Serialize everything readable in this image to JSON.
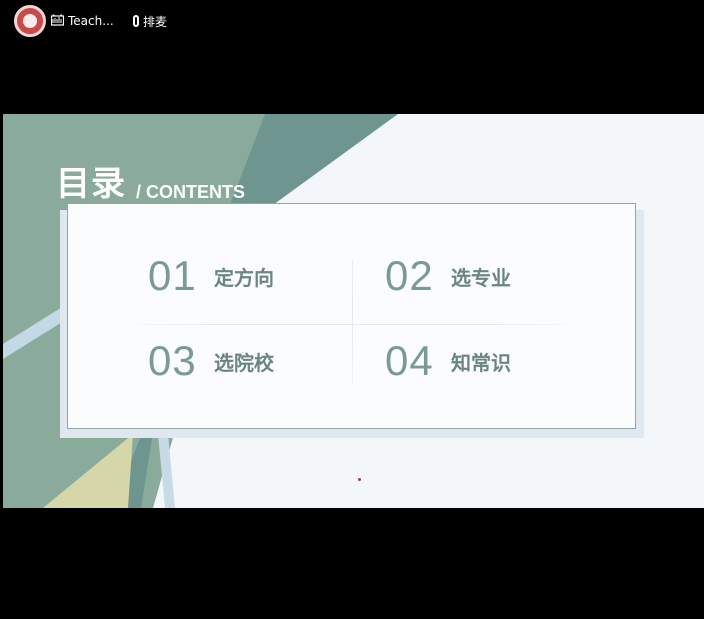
{
  "topbar": {
    "app_label": "Teach...",
    "mic_label": "排麦"
  },
  "slide": {
    "title": "目录",
    "subtitle": "/ CONTENTS",
    "items": [
      {
        "num": "01",
        "label": "定方向"
      },
      {
        "num": "02",
        "label": "选专业"
      },
      {
        "num": "03",
        "label": "选院校"
      },
      {
        "num": "04",
        "label": "知常识"
      }
    ]
  },
  "colors": {
    "accent_green": "#7a9a95",
    "label_green": "#6b8582",
    "background": "#f3f7fa"
  }
}
